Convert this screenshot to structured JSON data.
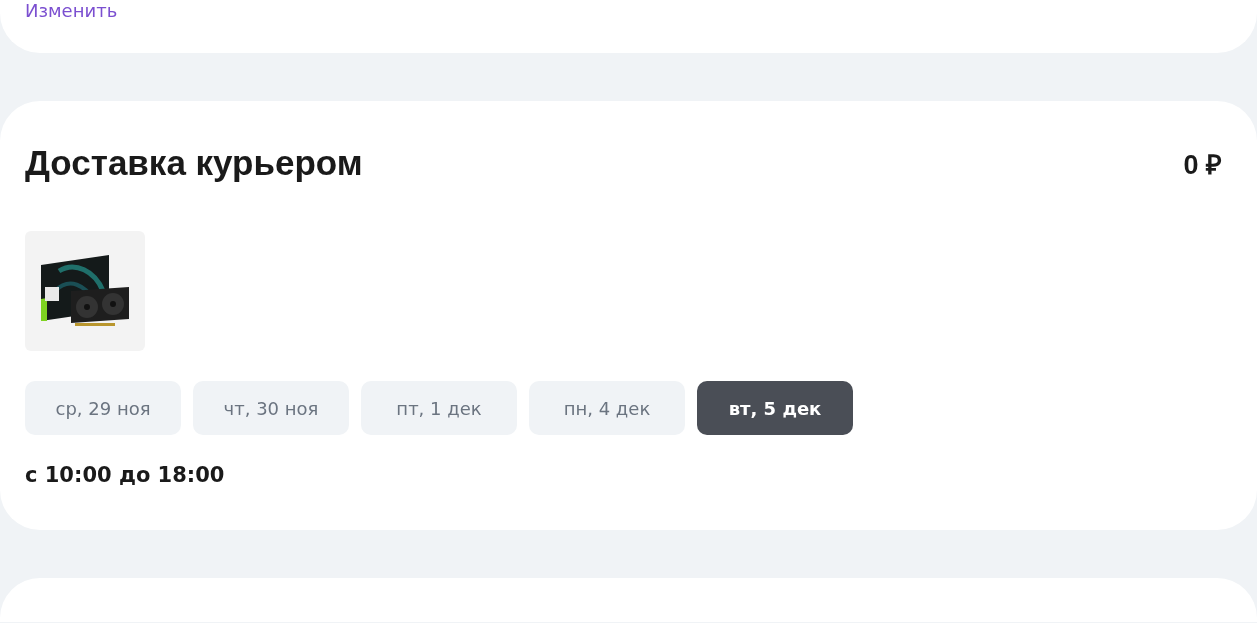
{
  "top_card": {
    "change_link": "Изменить"
  },
  "delivery": {
    "title": "Доставка курьером",
    "price": "0 ₽",
    "dates": [
      {
        "label": "ср, 29 ноя",
        "selected": false
      },
      {
        "label": "чт, 30 ноя",
        "selected": false
      },
      {
        "label": "пт, 1 дек",
        "selected": false
      },
      {
        "label": "пн, 4 дек",
        "selected": false
      },
      {
        "label": "вт, 5 дек",
        "selected": true
      }
    ],
    "time": "с 10:00 до 18:00"
  }
}
